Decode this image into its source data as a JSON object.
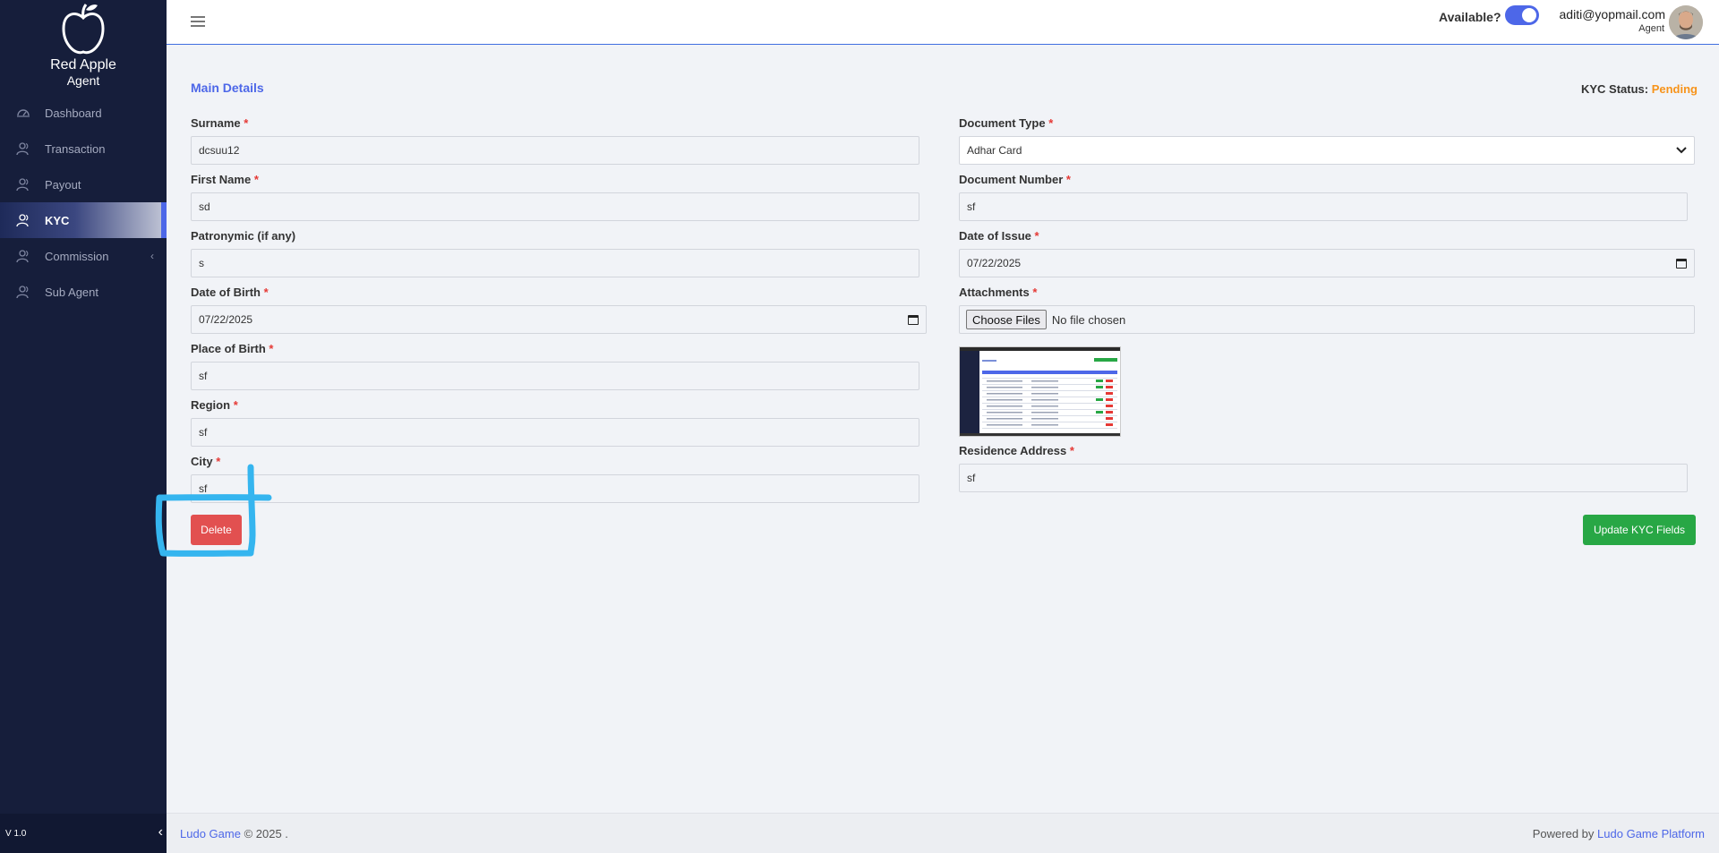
{
  "brand": {
    "name": "Red Apple",
    "role": "Agent"
  },
  "sidebar": {
    "items": [
      {
        "label": "Dashboard",
        "icon": "dashboard-icon"
      },
      {
        "label": "Transaction",
        "icon": "users-icon"
      },
      {
        "label": "Payout",
        "icon": "users-icon"
      },
      {
        "label": "KYC",
        "icon": "users-icon",
        "active": true
      },
      {
        "label": "Commission",
        "icon": "users-icon",
        "chevron": "‹"
      },
      {
        "label": "Sub Agent",
        "icon": "users-icon"
      }
    ],
    "version": "V 1.0",
    "collapse_glyph": "‹"
  },
  "topbar": {
    "available_label": "Available?",
    "available_on": true,
    "user_email": "aditi@yopmail.com",
    "user_role": "Agent"
  },
  "form": {
    "title": "Main Details",
    "kyc_status_label": "KYC Status:",
    "kyc_status_value": "Pending",
    "kyc_status_color": "#f7931a",
    "required_mark": "*",
    "left": {
      "surname": {
        "label": "Surname",
        "value": "dcsuu12"
      },
      "first_name": {
        "label": "First Name",
        "value": "sd"
      },
      "patronymic": {
        "label": "Patronymic (if any)",
        "value": "s"
      },
      "dob": {
        "label": "Date of Birth",
        "value": "07/22/2025"
      },
      "place_of_birth": {
        "label": "Place of Birth",
        "value": "sf"
      },
      "region": {
        "label": "Region",
        "value": "sf"
      },
      "city": {
        "label": "City",
        "value": "sf"
      }
    },
    "right": {
      "document_type": {
        "label": "Document Type",
        "value": "Adhar Card"
      },
      "document_number": {
        "label": "Document Number",
        "value": "sf"
      },
      "date_of_issue": {
        "label": "Date of Issue",
        "value": "07/22/2025"
      },
      "attachments": {
        "label": "Attachments",
        "button": "Choose Files",
        "status": "No file chosen"
      },
      "residence_address": {
        "label": "Residence Address",
        "value": "sf"
      }
    },
    "delete_label": "Delete",
    "update_label": "Update KYC Fields"
  },
  "footer": {
    "brand_link": "Ludo Game",
    "copyright": "© 2025 .",
    "powered_prefix": "Powered by",
    "powered_link": "Ludo Game Platform"
  },
  "colors": {
    "sidebar_bg": "#161e3b",
    "accent": "#4d67e8",
    "delete": "#e25050",
    "update": "#28a745",
    "annotation": "#35b5ef"
  }
}
